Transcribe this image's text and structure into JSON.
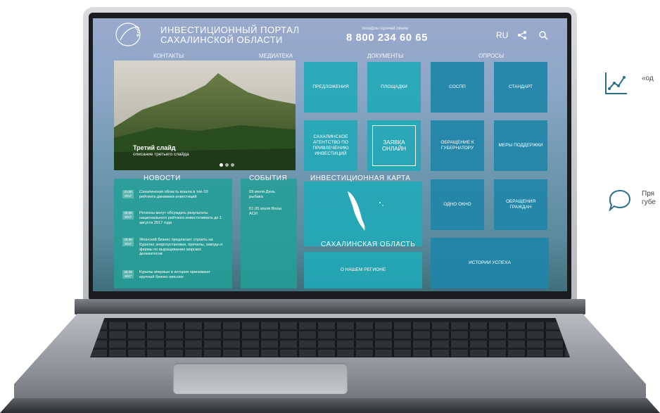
{
  "portal": {
    "title_line1": "ИНВЕСТИЦИОННЫЙ ПОРТАЛ",
    "title_line2": "САХАЛИНСКОЙ ОБЛАСТИ",
    "phone_caption": "телефон горячей линии",
    "phone": "8 800 234 60 65",
    "lang": "RU"
  },
  "nav": [
    "КОНТАКТЫ",
    "МЕДИАТЕКА",
    "ДОКУМЕНТЫ",
    "ОПРОСЫ"
  ],
  "slider": {
    "title": "Третий слайд",
    "subtitle": "описание третьего слайда"
  },
  "tiles": {
    "predlozheniya": "ПРЕДЛОЖЕНИЯ",
    "ploshchadki": "ПЛОЩАДКИ",
    "sospp": "СОСПП",
    "standart": "СТАНДАРТ",
    "agentstvo": "САХАЛИНСКОЕ АГЕНТСТВО ПО ПРИВЛЕЧЕНИЮ ИНВЕСТИЦИЙ",
    "zayavka": "ЗАЯВКА ОНЛАЙН",
    "obrashchenie_gubernatoru": "ОБРАЩЕНИЕ К ГУБЕРНАТОРУ",
    "mery": "МЕРЫ ПОДДЕРЖКИ",
    "odno_okno": "ОДНО ОКНО",
    "obrashcheniya_grazhdan": "ОБРАЩЕНИЯ ГРАЖДАН",
    "o_regione": "О НАШЕМ РЕГИОНЕ",
    "istorii": "ИСТОРИИ УСПЕХА"
  },
  "news": {
    "title": "НОВОСТИ",
    "items": [
      {
        "date": "31.08 2017",
        "text": "Сахалинская область вошла в топ-10 рейтинга динамики инвестиций"
      },
      {
        "date": "30.08 2017",
        "text": "Регионы могут обсуждать результаты национального рейтинга инвестклимата до 1 августа 2017 года"
      },
      {
        "date": "29.08 2017",
        "text": "Японский бизнес предлагает строить на Курилах энергоустановки, причалы, заводы и фермы по выращиванию морских деликатесов"
      },
      {
        "date": "28.08 2017",
        "text": "Курилы впервые в истории принимают крупный бизнес-миссию"
      }
    ]
  },
  "events": {
    "title": "СОБЫТИЯ",
    "items": [
      {
        "text": "09 июля День рыбака"
      },
      {
        "text": "01.05 июля Вхош АСИ"
      }
    ]
  },
  "map": {
    "title": "ИНВЕСТИЦИОННАЯ КАРТА",
    "region": "САХАЛИНСКАЯ ОБЛАСТЬ"
  },
  "side": {
    "item1": "«од",
    "item2_line1": "Пря",
    "item2_line2": "губе"
  },
  "icons": {
    "logo": "dolphin-logo-icon",
    "share": "share-icon",
    "search": "search-icon",
    "chart": "chart-growth-icon",
    "chat": "chat-bubble-icon"
  }
}
